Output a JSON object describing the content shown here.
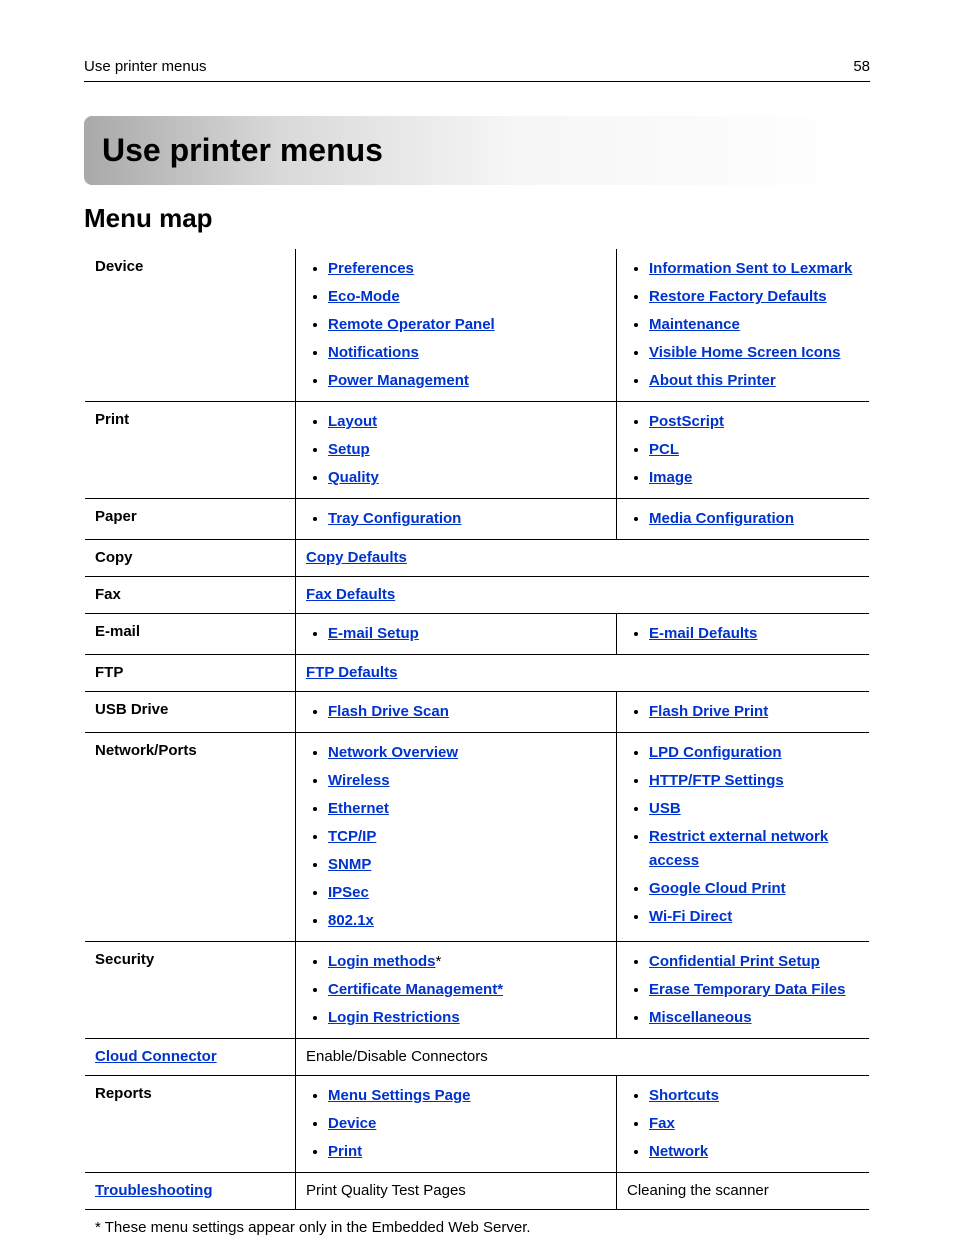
{
  "header": {
    "title": "Use printer menus",
    "page_number": "58"
  },
  "chapter_title": "Use printer menus",
  "section_title": "Menu map",
  "footnote": "* These menu settings appear only in the Embedded Web Server.",
  "rows": [
    {
      "category": {
        "text": "Device",
        "link": false
      },
      "col1": {
        "type": "list",
        "items": [
          {
            "text": "Preferences",
            "link": true
          },
          {
            "text": "Eco-Mode",
            "link": true
          },
          {
            "text": "Remote Operator Panel",
            "link": true
          },
          {
            "text": "Notifications",
            "link": true
          },
          {
            "text": "Power Management",
            "link": true
          }
        ]
      },
      "col2": {
        "type": "list",
        "items": [
          {
            "text": "Information Sent to Lexmark",
            "link": true
          },
          {
            "text": "Restore Factory Defaults",
            "link": true
          },
          {
            "text": "Maintenance",
            "link": true
          },
          {
            "text": "Visible Home Screen Icons",
            "link": true
          },
          {
            "text": "About this Printer",
            "link": true
          }
        ]
      }
    },
    {
      "category": {
        "text": "Print",
        "link": false
      },
      "col1": {
        "type": "list",
        "items": [
          {
            "text": "Layout",
            "link": true
          },
          {
            "text": "Setup",
            "link": true
          },
          {
            "text": "Quality",
            "link": true
          }
        ]
      },
      "col2": {
        "type": "list",
        "items": [
          {
            "text": "PostScript",
            "link": true
          },
          {
            "text": "PCL",
            "link": true
          },
          {
            "text": "Image",
            "link": true
          }
        ]
      }
    },
    {
      "category": {
        "text": "Paper",
        "link": false
      },
      "col1": {
        "type": "list",
        "items": [
          {
            "text": "Tray Configuration",
            "link": true
          }
        ]
      },
      "col2": {
        "type": "list",
        "items": [
          {
            "text": "Media Configuration",
            "link": true
          }
        ]
      }
    },
    {
      "category": {
        "text": "Copy",
        "link": false
      },
      "span": {
        "type": "single",
        "item": {
          "text": "Copy Defaults",
          "link": true
        }
      }
    },
    {
      "category": {
        "text": "Fax",
        "link": false
      },
      "span": {
        "type": "single",
        "item": {
          "text": "Fax Defaults",
          "link": true
        }
      }
    },
    {
      "category": {
        "text": "E-mail",
        "link": false
      },
      "col1": {
        "type": "list",
        "items": [
          {
            "text": "E-mail Setup",
            "link": true
          }
        ]
      },
      "col2": {
        "type": "list",
        "items": [
          {
            "text": "E-mail Defaults",
            "link": true
          }
        ]
      }
    },
    {
      "category": {
        "text": "FTP",
        "link": false
      },
      "span": {
        "type": "single",
        "item": {
          "text": "FTP Defaults",
          "link": true
        }
      }
    },
    {
      "category": {
        "text": "USB Drive",
        "link": false
      },
      "col1": {
        "type": "list",
        "items": [
          {
            "text": "Flash Drive Scan",
            "link": true
          }
        ]
      },
      "col2": {
        "type": "list",
        "items": [
          {
            "text": "Flash Drive Print",
            "link": true
          }
        ]
      }
    },
    {
      "category": {
        "text": "Network/Ports",
        "link": false
      },
      "col1": {
        "type": "list",
        "items": [
          {
            "text": "Network Overview",
            "link": true
          },
          {
            "text": "Wireless",
            "link": true
          },
          {
            "text": "Ethernet",
            "link": true
          },
          {
            "text": "TCP/IP",
            "link": true
          },
          {
            "text": "SNMP",
            "link": true
          },
          {
            "text": "IPSec",
            "link": true
          },
          {
            "text": "802.1x",
            "link": true
          }
        ]
      },
      "col2": {
        "type": "list",
        "items": [
          {
            "text": "LPD Configuration",
            "link": true
          },
          {
            "text": "HTTP/FTP Settings",
            "link": true
          },
          {
            "text": "USB",
            "link": true
          },
          {
            "text": "Restrict external network access",
            "link": true
          },
          {
            "text": "Google Cloud Print",
            "link": true
          },
          {
            "text": "Wi-Fi Direct",
            "link": true
          }
        ]
      }
    },
    {
      "category": {
        "text": "Security",
        "link": false
      },
      "col1": {
        "type": "list",
        "items": [
          {
            "text": "Login methods",
            "link": true,
            "star": true
          },
          {
            "text": "Certificate Management*",
            "link": true
          },
          {
            "text": "Login Restrictions",
            "link": true
          }
        ]
      },
      "col2": {
        "type": "list",
        "items": [
          {
            "text": "Confidential Print Setup",
            "link": true
          },
          {
            "text": "Erase Temporary Data Files",
            "link": true
          },
          {
            "text": "Miscellaneous",
            "link": true
          }
        ]
      }
    },
    {
      "category": {
        "text": "Cloud Connector",
        "link": true
      },
      "span": {
        "type": "single",
        "item": {
          "text": "Enable/Disable Connectors",
          "link": false
        }
      }
    },
    {
      "category": {
        "text": "Reports",
        "link": false
      },
      "col1": {
        "type": "list",
        "items": [
          {
            "text": "Menu Settings Page",
            "link": true
          },
          {
            "text": "Device",
            "link": true
          },
          {
            "text": "Print",
            "link": true
          }
        ]
      },
      "col2": {
        "type": "list",
        "items": [
          {
            "text": "Shortcuts",
            "link": true
          },
          {
            "text": "Fax",
            "link": true
          },
          {
            "text": "Network",
            "link": true
          }
        ]
      }
    },
    {
      "category": {
        "text": "Troubleshooting",
        "link": true
      },
      "col1": {
        "type": "plain",
        "text": "Print Quality Test Pages"
      },
      "col2": {
        "type": "plain",
        "text": "Cleaning the scanner"
      }
    }
  ]
}
